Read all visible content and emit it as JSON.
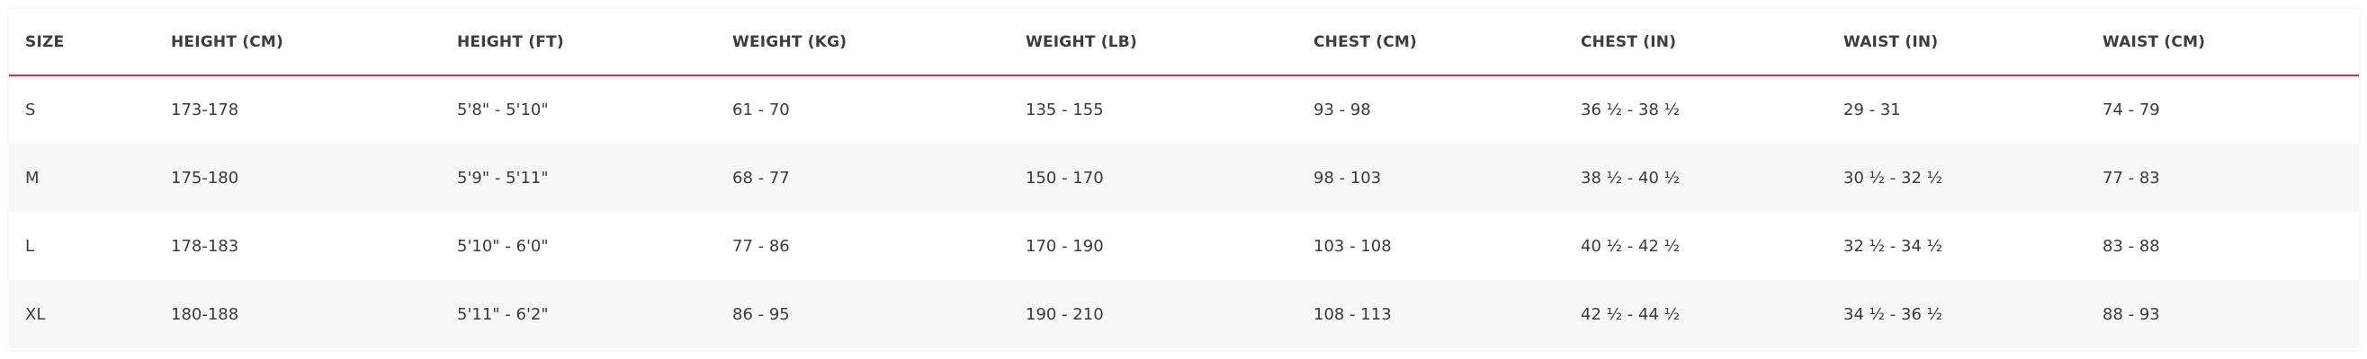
{
  "colors": {
    "header_rule": "#e02c3c",
    "alt_row": "#f7f7f7",
    "text": "#3a3a3a"
  },
  "table": {
    "headers": [
      "SIZE",
      "HEIGHT (CM)",
      "HEIGHT (FT)",
      "WEIGHT (KG)",
      "WEIGHT (LB)",
      "CHEST (CM)",
      "CHEST (IN)",
      "WAIST (IN)",
      "WAIST (CM)"
    ],
    "rows": [
      [
        "S",
        "173-178",
        "5'8\" - 5'10\"",
        "61 - 70",
        "135 - 155",
        "93 - 98",
        "36 ½ - 38 ½",
        "29 - 31",
        "74 - 79"
      ],
      [
        "M",
        "175-180",
        "5'9\" - 5'11\"",
        "68 - 77",
        "150 - 170",
        "98 - 103",
        "38 ½ - 40 ½",
        "30 ½ - 32 ½",
        "77 - 83"
      ],
      [
        "L",
        "178-183",
        "5'10\" - 6'0\"",
        "77 - 86",
        "170 - 190",
        "103 - 108",
        "40 ½ - 42 ½",
        "32 ½ - 34 ½",
        "83 - 88"
      ],
      [
        "XL",
        "180-188",
        "5'11\" - 6'2\"",
        "86 - 95",
        "190 - 210",
        "108 - 113",
        "42 ½ - 44 ½",
        "34 ½ - 36 ½",
        "88 - 93"
      ]
    ]
  }
}
